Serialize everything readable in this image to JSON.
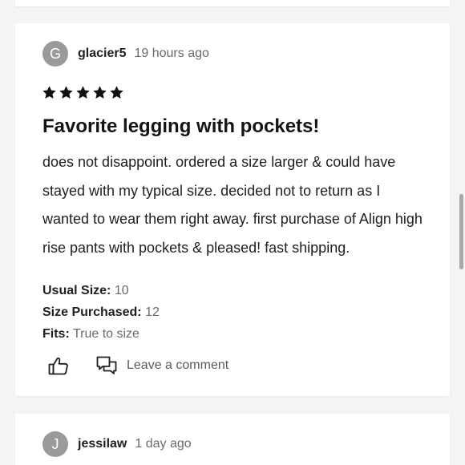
{
  "reviews": [
    {
      "avatar_letter": "G",
      "username": "glacier5",
      "time": "19 hours ago",
      "rating": 5,
      "rating_max": 5,
      "title": "Favorite legging with pockets!",
      "body": "does not disappoint. ordered a size larger & could have stayed with my typical size. decided not to return as I wanted to wear them right away. first purchase of Align high rise pants with pockets & pleased! fast shipping.",
      "specs": {
        "usual_size_label": "Usual Size:",
        "usual_size_value": "10",
        "size_purchased_label": "Size Purchased:",
        "size_purchased_value": "12",
        "fits_label": "Fits:",
        "fits_value": "True to size"
      },
      "actions": {
        "like_icon": "thumbs-up-icon",
        "comment_icon": "chat-bubbles-icon",
        "comment_label": "Leave a comment"
      }
    },
    {
      "avatar_letter": "J",
      "username": "jessilaw",
      "time": "1 day ago"
    }
  ],
  "colors": {
    "background": "#f4f4f4",
    "card": "#ffffff",
    "avatar": "#9a9a9a",
    "star": "#111111",
    "muted_text": "#6a6a6a"
  }
}
